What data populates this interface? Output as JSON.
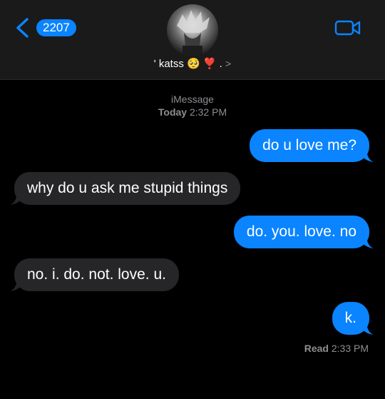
{
  "header": {
    "back_count": "2207",
    "contact_name": "' katss 🥺 ❣️ .",
    "chevron": ">"
  },
  "thread": {
    "service": "iMessage",
    "day": "Today",
    "time": "2:32 PM"
  },
  "messages": [
    {
      "direction": "outgoing",
      "text": "do u love me?"
    },
    {
      "direction": "incoming",
      "text": "why do u ask me stupid things"
    },
    {
      "direction": "outgoing",
      "text": "do. you. love. no"
    },
    {
      "direction": "incoming",
      "text": "no. i. do. not. love. u."
    },
    {
      "direction": "outgoing",
      "text": "k."
    }
  ],
  "receipt": {
    "label": "Read",
    "time": "2:33 PM"
  },
  "colors": {
    "accent": "#0a84ff",
    "incoming_bubble": "#262628",
    "header_bg": "#1a1a1a",
    "meta_text": "#8e8e93"
  },
  "icons": [
    "chevron-left-icon",
    "video-camera-icon"
  ]
}
